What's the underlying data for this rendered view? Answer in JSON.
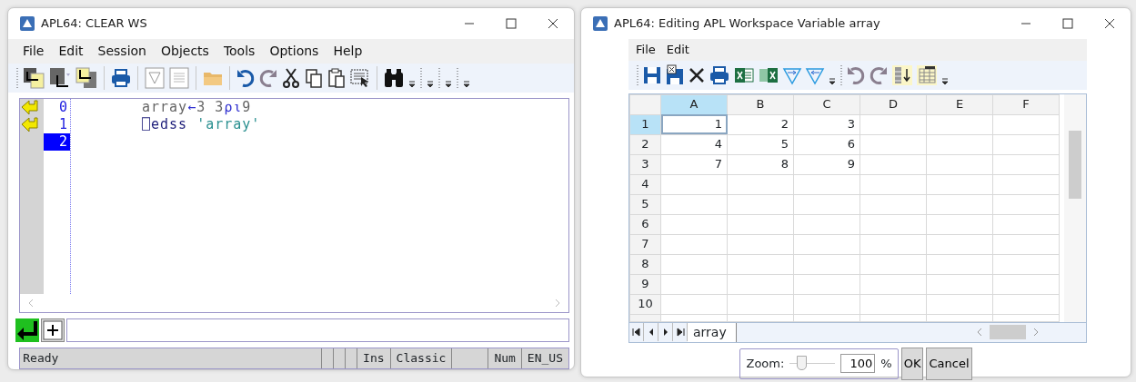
{
  "session_window": {
    "title": "APL64: CLEAR WS",
    "menu": [
      "File",
      "Edit",
      "Session",
      "Objects",
      "Tools",
      "Options",
      "Help"
    ],
    "lines": [
      {
        "number": "0",
        "marker": true,
        "selected": false,
        "tokens": [
          {
            "text": "array",
            "kind": "name"
          },
          {
            "text": "←",
            "kind": "primitive"
          },
          {
            "text": "3 3",
            "kind": "name"
          },
          {
            "text": "⍴⍳",
            "kind": "primitive"
          },
          {
            "text": "9",
            "kind": "name"
          }
        ]
      },
      {
        "number": "1",
        "marker": true,
        "selected": false,
        "tokens": [
          {
            "text": "⎕edss",
            "kind": "system"
          },
          {
            "text": " 'array'",
            "kind": "string"
          }
        ]
      },
      {
        "number": "2",
        "marker": false,
        "selected": true
      }
    ],
    "status": [
      "Ready",
      "Ins",
      "Classic",
      "Num",
      "EN_US"
    ]
  },
  "editor_window": {
    "title": "APL64: Editing APL Workspace Variable array",
    "menu": [
      "File",
      "Edit"
    ],
    "columns": [
      {
        "label": "A",
        "selected": true
      },
      {
        "label": "B",
        "selected": false
      },
      {
        "label": "C",
        "selected": false
      },
      {
        "label": "D",
        "selected": false
      },
      {
        "label": "E",
        "selected": false
      },
      {
        "label": "F",
        "selected": false
      }
    ],
    "rows": [
      {
        "label": "1",
        "selected": true,
        "cells": [
          "1",
          "2",
          "3"
        ]
      },
      {
        "label": "2",
        "selected": false,
        "cells": [
          "4",
          "5",
          "6"
        ]
      },
      {
        "label": "3",
        "selected": false,
        "cells": [
          "7",
          "8",
          "9"
        ]
      },
      {
        "label": "4",
        "selected": false
      },
      {
        "label": "5",
        "selected": false
      },
      {
        "label": "6",
        "selected": false
      },
      {
        "label": "7",
        "selected": false
      },
      {
        "label": "8",
        "selected": false
      },
      {
        "label": "9",
        "selected": false
      },
      {
        "label": "10",
        "selected": false
      }
    ],
    "sheet_tab": "array",
    "zoom": {
      "label": "Zoom:",
      "level": 0.2,
      "value": "100",
      "unit": "%"
    },
    "buttons": [
      "OK",
      "Cancel"
    ]
  }
}
